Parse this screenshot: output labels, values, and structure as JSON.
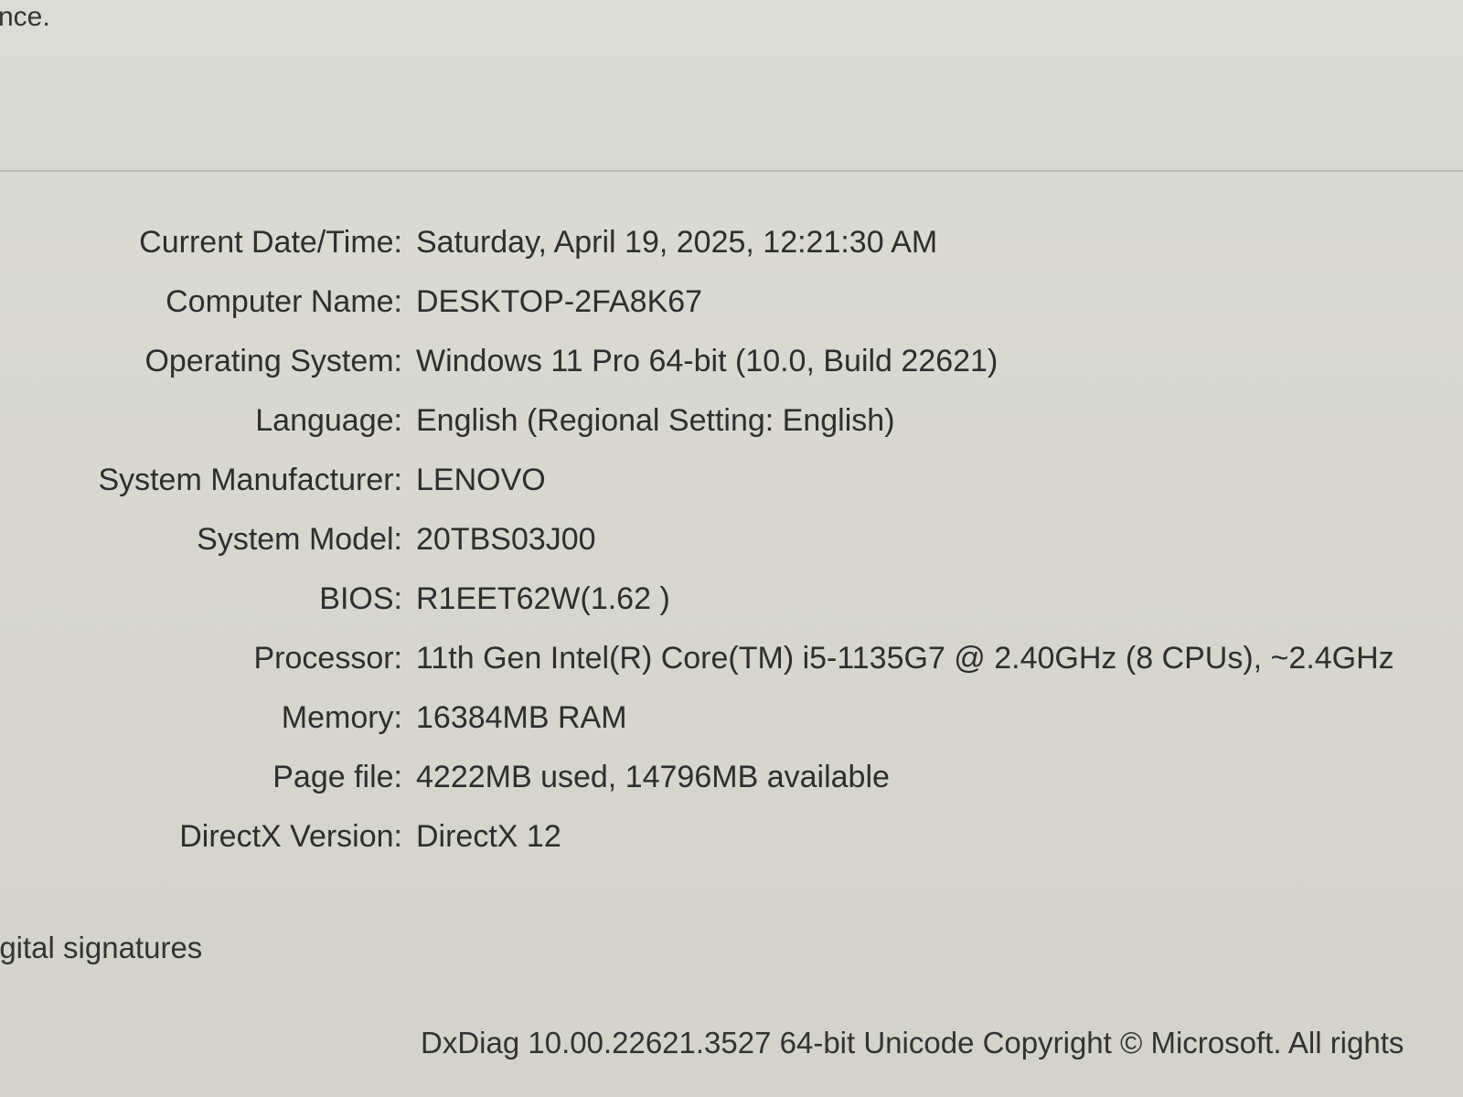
{
  "header": {
    "partial_text": "nce."
  },
  "system_info": [
    {
      "label": "Current Date/Time:",
      "value": "Saturday, April 19, 2025, 12:21:30 AM"
    },
    {
      "label": "Computer Name:",
      "value": "DESKTOP-2FA8K67"
    },
    {
      "label": "Operating System:",
      "value": "Windows 11 Pro 64-bit (10.0, Build 22621)"
    },
    {
      "label": "Language:",
      "value": "English (Regional Setting: English)"
    },
    {
      "label": "System Manufacturer:",
      "value": "LENOVO"
    },
    {
      "label": "System Model:",
      "value": "20TBS03J00"
    },
    {
      "label": "BIOS:",
      "value": "R1EET62W(1.62 )"
    },
    {
      "label": "Processor:",
      "value": "11th Gen Intel(R) Core(TM) i5-1135G7 @ 2.40GHz (8 CPUs), ~2.4GHz"
    },
    {
      "label": "Memory:",
      "value": "16384MB RAM"
    },
    {
      "label": "Page file:",
      "value": "4222MB used, 14796MB available"
    },
    {
      "label": "DirectX Version:",
      "value": "DirectX 12"
    }
  ],
  "signatures": {
    "label": "igital signatures"
  },
  "footer": {
    "text": "DxDiag 10.00.22621.3527 64-bit Unicode  Copyright © Microsoft. All rights"
  }
}
